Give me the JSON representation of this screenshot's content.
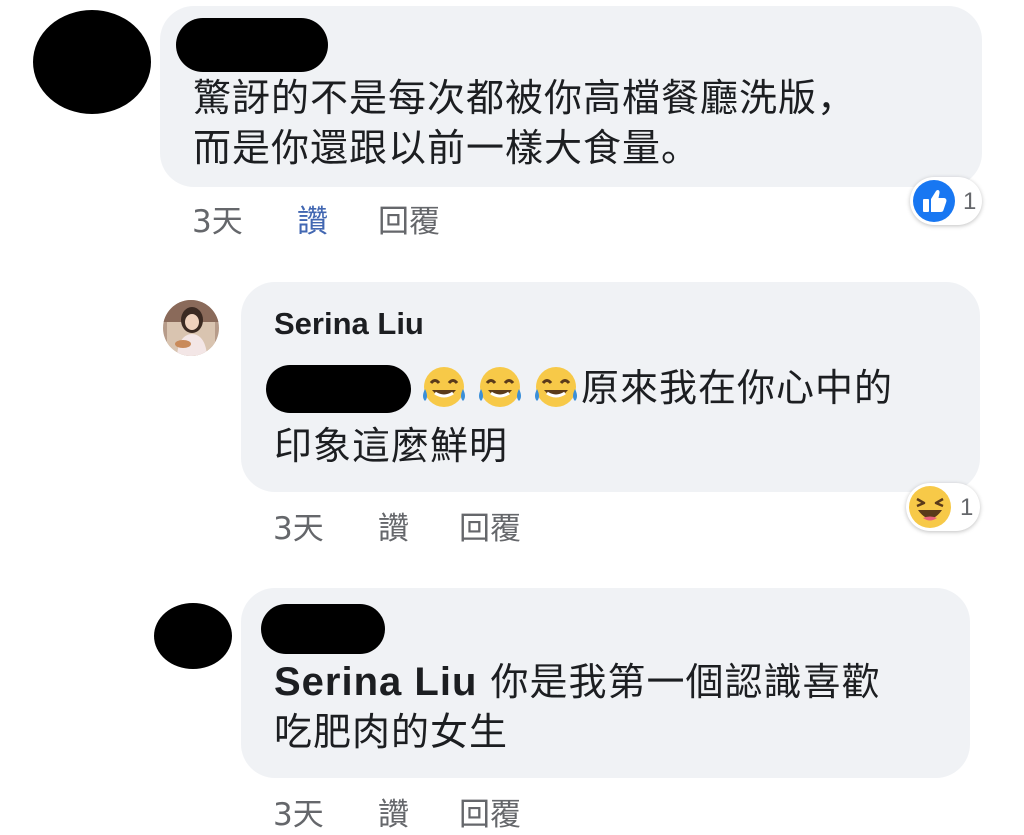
{
  "comments": [
    {
      "author_redacted": true,
      "text_lines": [
        "驚訝的不是每次都被你高檔餐廳洗版，",
        "而是你還跟以前一樣大食量。"
      ],
      "meta": {
        "time": "3天",
        "like": "讚",
        "reply": "回覆",
        "liked": true
      },
      "reaction": {
        "icon": "thumbs-up-reaction-icon",
        "count": "1"
      }
    },
    {
      "author": "Serina Liu",
      "avatar_icon": "profile-photo",
      "text_line1_after": "原來我在你心中的",
      "text_line2": "印象這麼鮮明",
      "emojis": [
        "tears-of-joy-emoji",
        "tears-of-joy-emoji",
        "tears-of-joy-emoji"
      ],
      "meta": {
        "time": "3天",
        "like": "讚",
        "reply": "回覆",
        "liked": false
      },
      "reaction": {
        "icon": "haha-reaction-icon",
        "count": "1"
      }
    },
    {
      "author_redacted": true,
      "mention": "Serina Liu",
      "text_line1_after": " 你是我第一個認識喜歡",
      "text_line2": "吃肥肉的女生",
      "meta": {
        "time": "3天",
        "like": "讚",
        "reply": "回覆",
        "liked": false
      }
    }
  ],
  "colors": {
    "bubble": "#f0f2f5",
    "like_active": "#4267b2",
    "meta_text": "#65676b",
    "reaction_blue": "#1877f2",
    "reaction_yellow": "#f7c948"
  }
}
